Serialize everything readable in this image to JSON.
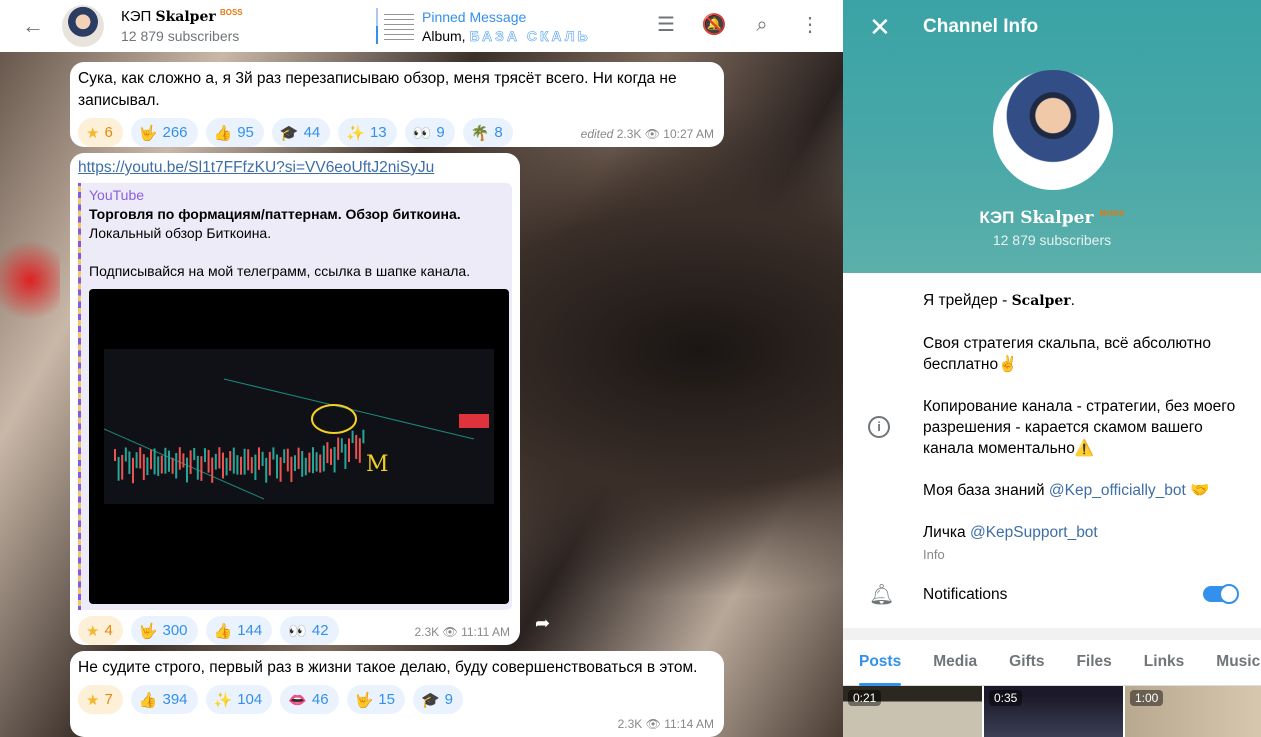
{
  "header": {
    "channel_name": "КЭП",
    "channel_name_styled": "Skalper",
    "badge": "BOSS",
    "subscribers": "12 879 subscribers",
    "pinned": {
      "title": "Pinned Message",
      "prefix": "Album,",
      "text": "БАЗА СКАЛЬ"
    }
  },
  "messages": [
    {
      "text": "Сука, как сложно а, я 3й раз перезаписываю обзор, меня трясёт всего. Ни когда не записывал.",
      "reactions": [
        {
          "emoji": "★",
          "count": "6",
          "paid": true
        },
        {
          "emoji": "🤟",
          "count": "266"
        },
        {
          "emoji": "👍",
          "count": "95"
        },
        {
          "emoji": "🎓",
          "count": "44"
        },
        {
          "emoji": "✨",
          "count": "13"
        },
        {
          "emoji": "👀",
          "count": "9"
        },
        {
          "emoji": "🌴",
          "count": "8"
        }
      ],
      "edited": "edited",
      "views": "2.3K",
      "time": "10:27 AM"
    },
    {
      "link": "https://youtu.be/Sl1t7FFfzKU?si=VV6eoUftJ2niSyJu",
      "preview": {
        "site": "YouTube",
        "title": "Торговля по формациям/паттернам.  Обзор биткоина.",
        "line1": "Локальный обзор Биткоина.",
        "line2": "Подписывайся  на мой телеграмм, ссылка в шапке канала."
      },
      "reactions": [
        {
          "emoji": "★",
          "count": "4",
          "paid": true
        },
        {
          "emoji": "🤟",
          "count": "300"
        },
        {
          "emoji": "👍",
          "count": "144"
        },
        {
          "emoji": "👀",
          "count": "42"
        }
      ],
      "views": "2.3K",
      "time": "11:11 AM"
    },
    {
      "text": "Не судите строго, первый раз в жизни такое делаю, буду совершенствоваться в этом.",
      "reactions": [
        {
          "emoji": "★",
          "count": "7",
          "paid": true
        },
        {
          "emoji": "👍",
          "count": "394"
        },
        {
          "emoji": "✨",
          "count": "104"
        },
        {
          "emoji": "👄",
          "count": "46"
        },
        {
          "emoji": "🤟",
          "count": "15"
        },
        {
          "emoji": "🎓",
          "count": "9"
        }
      ],
      "views": "2.3K",
      "time": "11:14 AM"
    }
  ],
  "panel": {
    "title": "Channel Info",
    "name": "КЭП",
    "name_styled": "Skalper",
    "badge": "BOSS",
    "subscribers": "12 879 subscribers",
    "description": {
      "p1_text": "Я трейдер - ",
      "p1_styled": "Scalper",
      "p1_end": ".",
      "p2": "Своя стратегия скальпа, всё абсолютно бесплатно✌️",
      "p3": "Копирование канала - стратегии, без моего разрешения - карается скамом вашего канала моментально⚠️",
      "p4_text": "Моя база знаний ",
      "p4_link": "@Kep_officially_bot",
      "p4_emoji": "🤝",
      "p5_text": "Личка ",
      "p5_link": "@KepSupport_bot",
      "label": "Info"
    },
    "notifications_label": "Notifications",
    "notifications_on": true,
    "tabs": [
      "Posts",
      "Media",
      "Gifts",
      "Files",
      "Links",
      "Music"
    ],
    "thumbnails": [
      {
        "duration": "0:21"
      },
      {
        "duration": "0:35"
      },
      {
        "duration": "1:00"
      }
    ]
  }
}
